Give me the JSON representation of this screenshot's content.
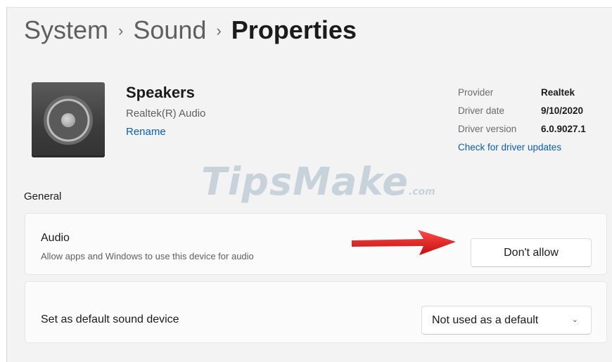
{
  "breadcrumb": {
    "items": [
      "System",
      "Sound",
      "Properties"
    ],
    "separator": "›"
  },
  "device": {
    "icon": "speaker-icon",
    "name": "Speakers",
    "subtitle": "Realtek(R) Audio",
    "rename_label": "Rename"
  },
  "driver_info": {
    "provider_label": "Provider",
    "provider_value": "Realtek",
    "date_label": "Driver date",
    "date_value": "9/10/2020",
    "version_label": "Driver version",
    "version_value": "6.0.9027.1",
    "check_updates_label": "Check for driver updates"
  },
  "watermark": {
    "text": "TipsMake",
    "suffix": ".com"
  },
  "general": {
    "heading": "General",
    "audio": {
      "title": "Audio",
      "description": "Allow apps and Windows to use this device for audio",
      "button_label": "Don't allow"
    },
    "default_device": {
      "label": "Set as default sound device",
      "selected": "Not used as a default"
    }
  },
  "colors": {
    "accent_link": "#0a5fb4",
    "arrow": "#e01b1b",
    "background": "#f3f3f3"
  }
}
